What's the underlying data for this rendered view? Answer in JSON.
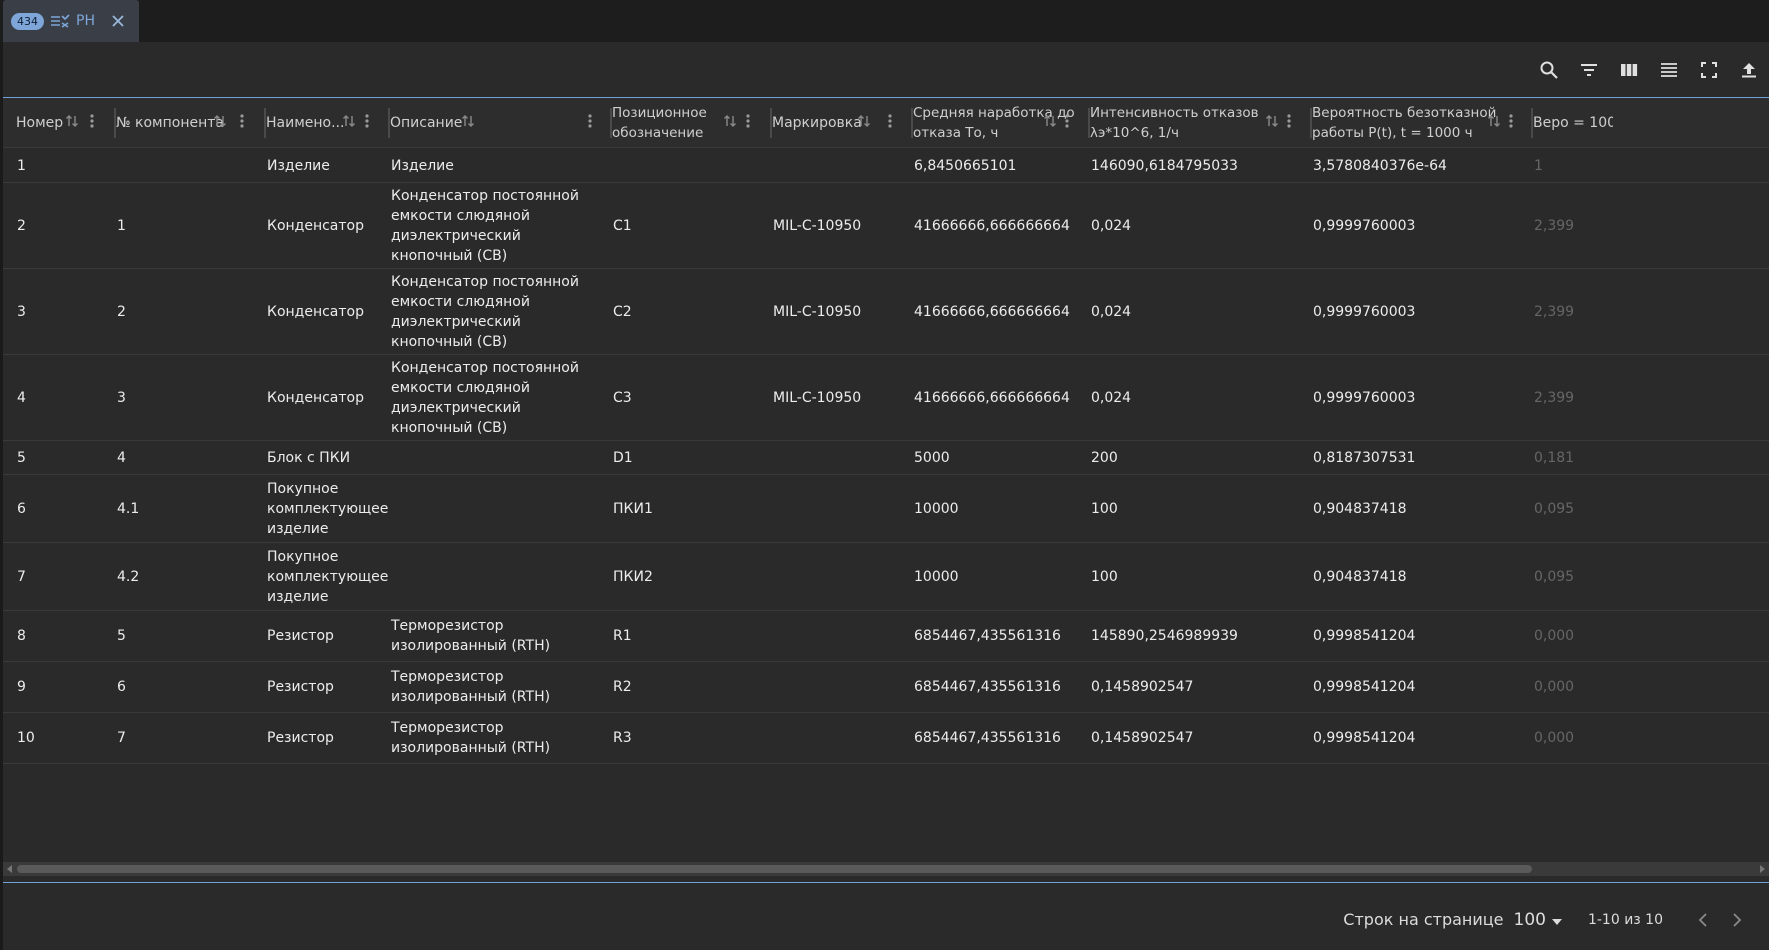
{
  "tab": {
    "badge": "434",
    "label": "РН"
  },
  "toolbar": [
    "search-icon",
    "filter-icon",
    "columns-icon",
    "density-icon",
    "fullscreen-icon",
    "export-icon"
  ],
  "columns": [
    {
      "key": "num",
      "label": "Номер"
    },
    {
      "key": "comp",
      "label": "№ компонента"
    },
    {
      "key": "name",
      "label": "Наимено..."
    },
    {
      "key": "desc",
      "label": "Описание"
    },
    {
      "key": "pos",
      "label": "Позиционное обозначение"
    },
    {
      "key": "mark",
      "label": "Маркировка"
    },
    {
      "key": "mtbf",
      "label": "Средняя наработка до отказа То, ч"
    },
    {
      "key": "rate",
      "label": "Интенсивность отказов λэ*10^6, 1/ч"
    },
    {
      "key": "prob",
      "label": "Вероятность безотказной работы P(t), t = 1000 ч"
    },
    {
      "key": "extra",
      "label": "Веро = 100"
    }
  ],
  "rows": [
    {
      "num": "1",
      "comp": "",
      "name": "Изделие",
      "desc": "Изделие",
      "pos": "",
      "mark": "",
      "mtbf": "6,8450665101",
      "rate": "146090,6184795033",
      "prob": "3,5780840376e-64",
      "extra": "1"
    },
    {
      "num": "2",
      "comp": "1",
      "name": "Конденсатор",
      "desc": "Конденсатор постоянной емкости слюдяной диэлектрический кнопочный (CB)",
      "pos": "C1",
      "mark": "MIL-C-10950",
      "mtbf": "41666666,666666664",
      "rate": "0,024",
      "prob": "0,9999760003",
      "extra": "2,399"
    },
    {
      "num": "3",
      "comp": "2",
      "name": "Конденсатор",
      "desc": "Конденсатор постоянной емкости слюдяной диэлектрический кнопочный (CB)",
      "pos": "C2",
      "mark": "MIL-C-10950",
      "mtbf": "41666666,666666664",
      "rate": "0,024",
      "prob": "0,9999760003",
      "extra": "2,399"
    },
    {
      "num": "4",
      "comp": "3",
      "name": "Конденсатор",
      "desc": "Конденсатор постоянной емкости слюдяной диэлектрический кнопочный (CB)",
      "pos": "C3",
      "mark": "MIL-C-10950",
      "mtbf": "41666666,666666664",
      "rate": "0,024",
      "prob": "0,9999760003",
      "extra": "2,399"
    },
    {
      "num": "5",
      "comp": "4",
      "name": "Блок с ПКИ",
      "desc": "",
      "pos": "D1",
      "mark": "",
      "mtbf": "5000",
      "rate": "200",
      "prob": "0,8187307531",
      "extra": "0,181"
    },
    {
      "num": "6",
      "comp": "4.1",
      "name": "Покупное комплектующее изделие",
      "desc": "",
      "pos": "ПКИ1",
      "mark": "",
      "mtbf": "10000",
      "rate": "100",
      "prob": "0,904837418",
      "extra": "0,095"
    },
    {
      "num": "7",
      "comp": "4.2",
      "name": "Покупное комплектующее изделие",
      "desc": "",
      "pos": "ПКИ2",
      "mark": "",
      "mtbf": "10000",
      "rate": "100",
      "prob": "0,904837418",
      "extra": "0,095"
    },
    {
      "num": "8",
      "comp": "5",
      "name": "Резистор",
      "desc": "Терморезистор изолированный (RTH)",
      "pos": "R1",
      "mark": "",
      "mtbf": "6854467,435561316",
      "rate": "145890,2546989939",
      "prob": "0,9998541204",
      "extra": "0,000"
    },
    {
      "num": "9",
      "comp": "6",
      "name": "Резистор",
      "desc": "Терморезистор изолированный (RTH)",
      "pos": "R2",
      "mark": "",
      "mtbf": "6854467,435561316",
      "rate": "0,1458902547",
      "prob": "0,9998541204",
      "extra": "0,000"
    },
    {
      "num": "10",
      "comp": "7",
      "name": "Резистор",
      "desc": "Терморезистор изолированный (RTH)",
      "pos": "R3",
      "mark": "",
      "mtbf": "6854467,435561316",
      "rate": "0,1458902547",
      "prob": "0,9998541204",
      "extra": "0,000"
    }
  ],
  "footer": {
    "rows_per_page_label": "Строк на странице",
    "rows_per_page_value": "100",
    "range": "1-10 из 10"
  }
}
